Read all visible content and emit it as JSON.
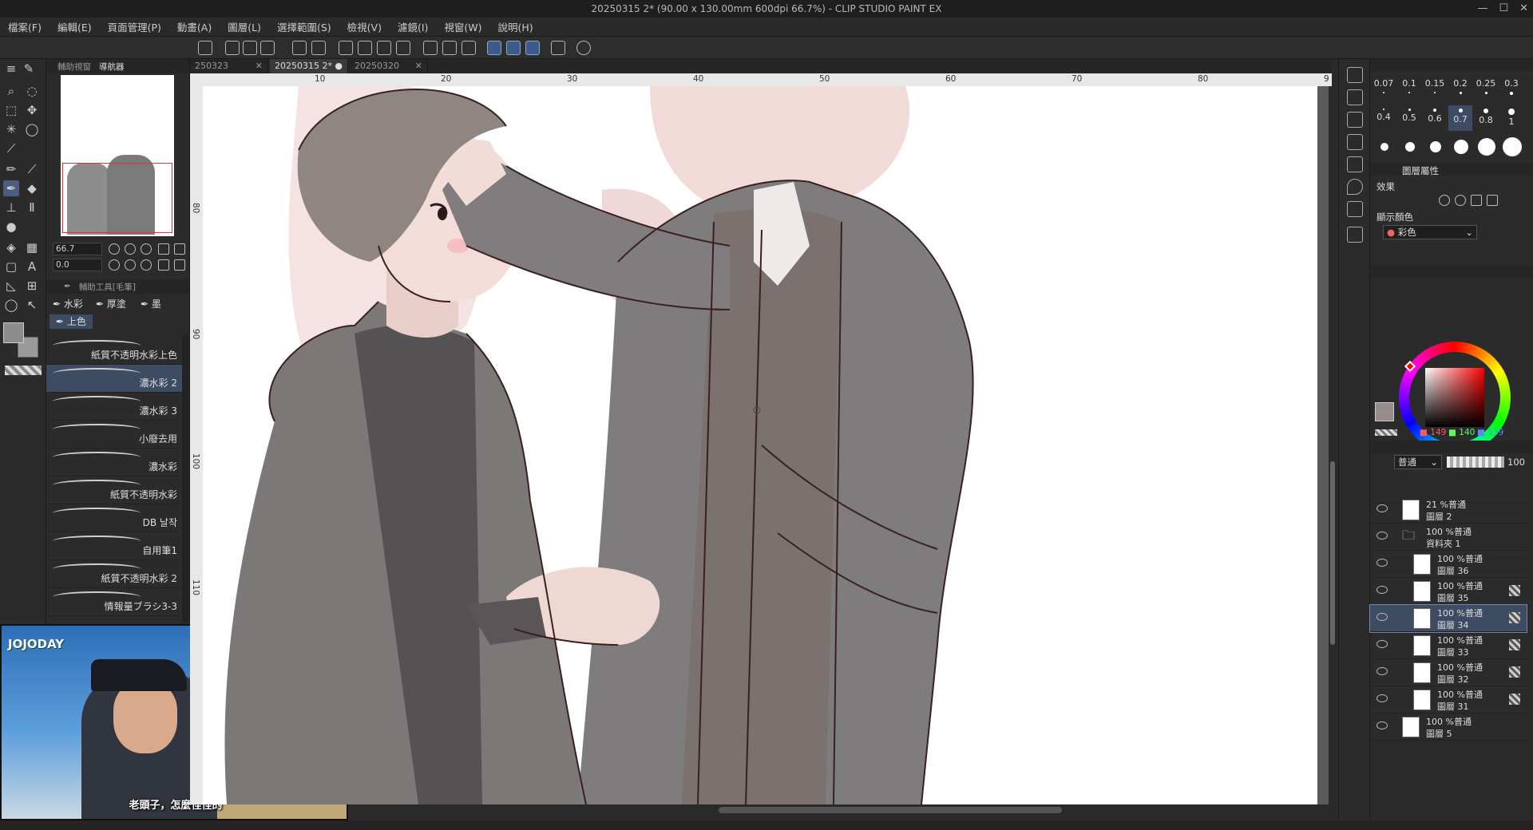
{
  "window": {
    "title": "20250315 2* (90.00 x 130.00mm 600dpi 66.7%)  - CLIP STUDIO PAINT EX"
  },
  "menu": [
    "檔案(F)",
    "編輯(E)",
    "頁面管理(P)",
    "動畫(A)",
    "圖層(L)",
    "選擇範圍(S)",
    "檢視(V)",
    "濾鏡(I)",
    "視窗(W)",
    "說明(H)"
  ],
  "navigator": {
    "tabs": [
      "輔助視窗",
      "導航器"
    ],
    "zoom": "66.7",
    "rotation": "0.0"
  },
  "subtool": {
    "header": "輔助工具[毛筆]",
    "groups": [
      "水彩",
      "厚塗",
      "墨"
    ],
    "active_group": "上色",
    "brushes": [
      "紙質不透明水彩上色",
      "濃水彩 2",
      "濃水彩 3",
      "小廢去用",
      "濃水彩",
      "紙質不透明水彩",
      "DB 날작",
      "自用筆1",
      "紙質不透明水彩 2",
      "情報量ブラシ3-3"
    ],
    "selected_brush_index": 1
  },
  "video": {
    "logo": "JOJODAY",
    "subtitle": "老頭子，怎麼怪怪的"
  },
  "doc_tabs": [
    {
      "label": "250323",
      "active": false
    },
    {
      "label": "20250315 2*",
      "active": true
    },
    {
      "label": "20250320",
      "active": false
    }
  ],
  "ruler": {
    "h_labels": [
      "10",
      "20",
      "30",
      "40",
      "50",
      "60",
      "70",
      "80",
      "9"
    ],
    "v_labels": [
      "80",
      "90",
      "100",
      "110"
    ]
  },
  "brush_size": {
    "values": [
      "0.07",
      "0.1",
      "0.15",
      "0.2",
      "0.25",
      "0.3",
      "0.4",
      "0.5",
      "0.6",
      "0.7",
      "0.8",
      "1"
    ],
    "selected": "0.7"
  },
  "layer_property": {
    "tab": "圖層屬性",
    "effect_label": "效果",
    "display_color_label": "顯示顏色",
    "display_color_value": "彩色"
  },
  "color": {
    "r": "149",
    "g": "140",
    "b": "139",
    "current": "#958c8b"
  },
  "layers_panel": {
    "blend_mode": "普通",
    "opacity": "100",
    "layers": [
      {
        "l1": "21 %普通",
        "l2": "圖層 2",
        "indent": 0,
        "selected": false,
        "folder": false
      },
      {
        "l1": "100 %普通",
        "l2": "資料夾 1",
        "indent": 0,
        "selected": false,
        "folder": true
      },
      {
        "l1": "100 %普通",
        "l2": "圖層 36",
        "indent": 1,
        "selected": false,
        "folder": false
      },
      {
        "l1": "100 %普通",
        "l2": "圖層 35",
        "indent": 1,
        "selected": false,
        "folder": false
      },
      {
        "l1": "100 %普通",
        "l2": "圖層 34",
        "indent": 1,
        "selected": true,
        "folder": false
      },
      {
        "l1": "100 %普通",
        "l2": "圖層 33",
        "indent": 1,
        "selected": false,
        "folder": false
      },
      {
        "l1": "100 %普通",
        "l2": "圖層 32",
        "indent": 1,
        "selected": false,
        "folder": false
      },
      {
        "l1": "100 %普通",
        "l2": "圖層 31",
        "indent": 1,
        "selected": false,
        "folder": false
      },
      {
        "l1": "100 %普通",
        "l2": "圖層 5",
        "indent": 0,
        "selected": false,
        "folder": false
      }
    ]
  }
}
